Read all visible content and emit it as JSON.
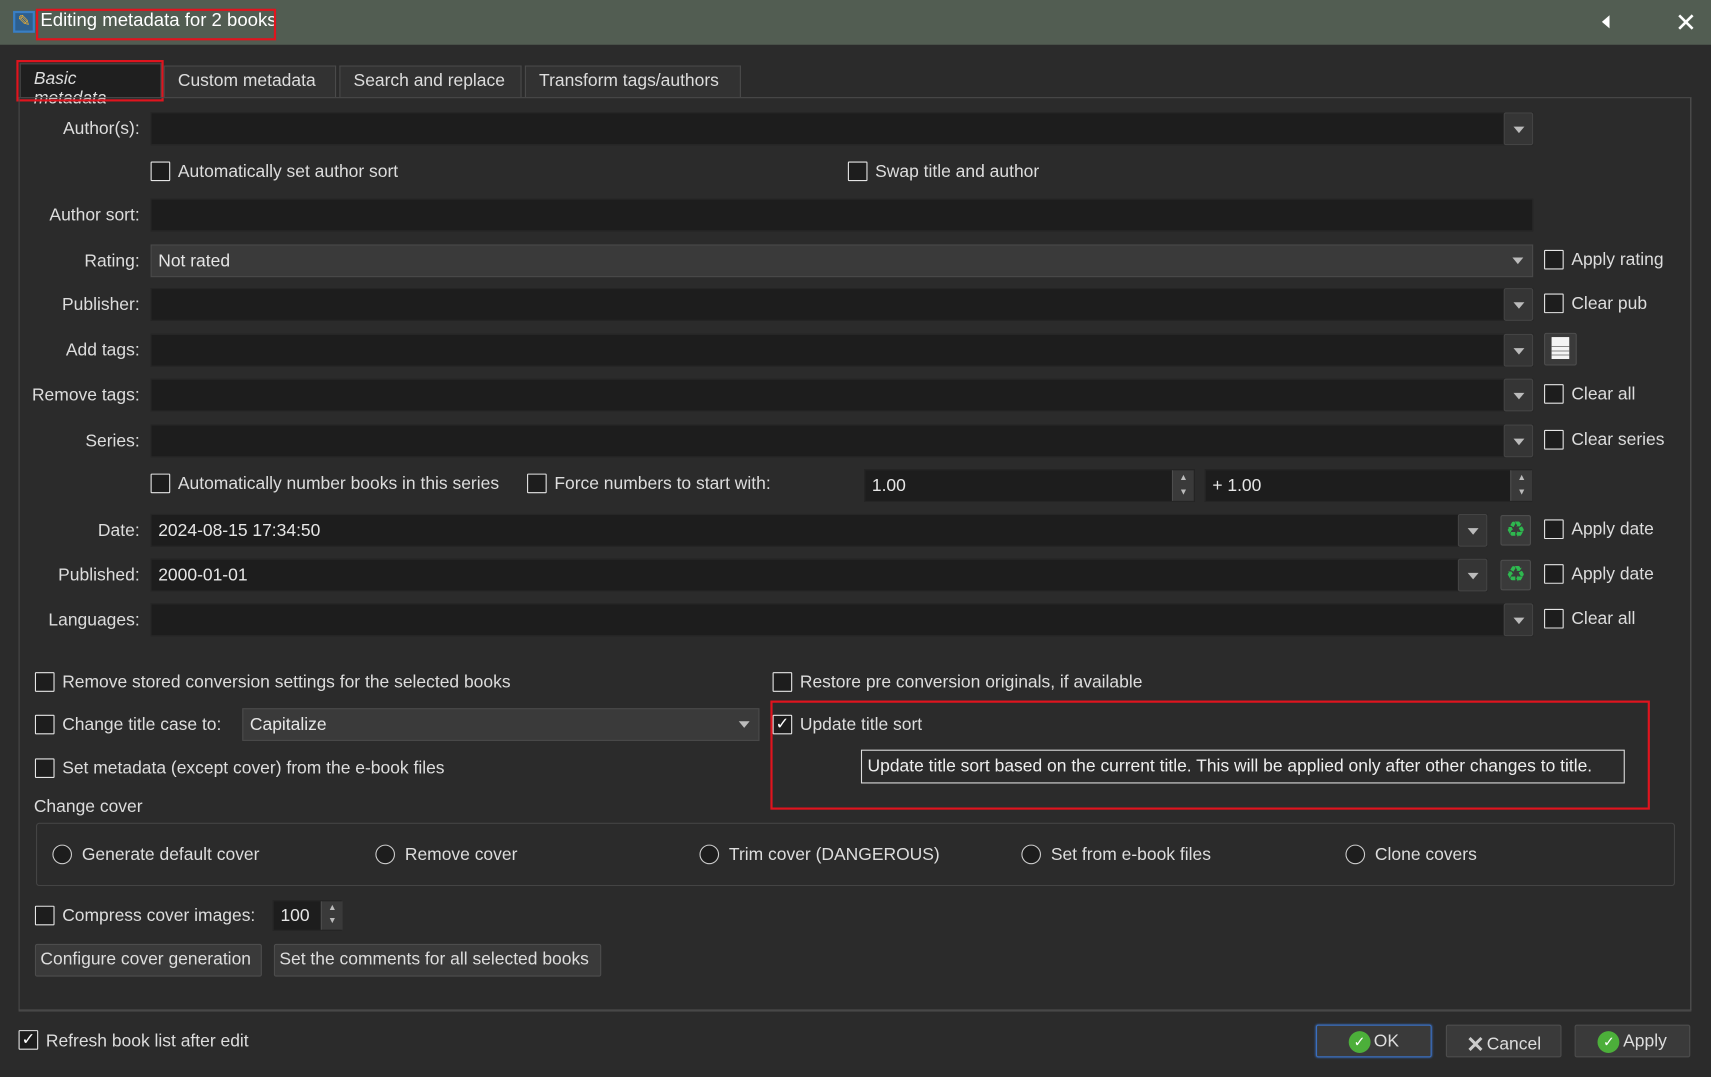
{
  "window": {
    "title": "Editing metadata for 2 books",
    "collapse_icon": "triangle-left-icon",
    "close_icon": "close-icon"
  },
  "tabs": [
    {
      "label": "Basic metadata"
    },
    {
      "label": "Custom metadata"
    },
    {
      "label": "Search and replace"
    },
    {
      "label": "Transform tags/authors"
    }
  ],
  "fields": {
    "authors": {
      "label": "Author(s):",
      "value": ""
    },
    "auto_author_sort": "Automatically set author sort",
    "swap_title_author": "Swap title and author",
    "author_sort": {
      "label": "Author sort:",
      "value": ""
    },
    "rating": {
      "label": "Rating:",
      "value": "Not rated",
      "apply": "Apply rating"
    },
    "publisher": {
      "label": "Publisher:",
      "value": "",
      "clear": "Clear pub"
    },
    "add_tags": {
      "label": "Add tags:",
      "value": ""
    },
    "remove_tags": {
      "label": "Remove tags:",
      "value": "",
      "clear": "Clear all"
    },
    "series": {
      "label": "Series:",
      "value": "",
      "clear": "Clear series"
    },
    "auto_number": "Automatically number books in this series",
    "force_numbers": "Force numbers to start with:",
    "series_start": "1.00",
    "series_increment": "+ 1.00",
    "date": {
      "label": "Date:",
      "value": "2024-08-15 17:34:50",
      "apply": "Apply date"
    },
    "published": {
      "label": "Published:",
      "value": "2000-01-01",
      "apply": "Apply date"
    },
    "languages": {
      "label": "Languages:",
      "value": "",
      "clear": "Clear all"
    }
  },
  "options": {
    "remove_conversion": "Remove stored conversion settings for the selected books",
    "restore_originals": "Restore pre conversion originals, if available",
    "change_title_case": "Change title case to:",
    "title_case_value": "Capitalize",
    "update_title_sort": "Update title sort",
    "update_title_sort_checked": true,
    "tooltip": "Update title sort based on the current title. This will be applied only after other changes to title.",
    "set_metadata_from_files": "Set metadata (except cover) from the e-book files"
  },
  "cover": {
    "label": "Change cover",
    "radios": [
      "Generate default cover",
      "Remove cover",
      "Trim cover (DANGEROUS)",
      "Set from e-book files",
      "Clone covers"
    ],
    "compress": "Compress cover images:",
    "compress_value": "100",
    "configure_btn": "Configure cover generation",
    "comments_btn": "Set the comments for all selected books"
  },
  "footer": {
    "refresh": "Refresh book list after edit",
    "refresh_checked": true,
    "ok": "OK",
    "cancel": "Cancel",
    "apply": "Apply"
  }
}
